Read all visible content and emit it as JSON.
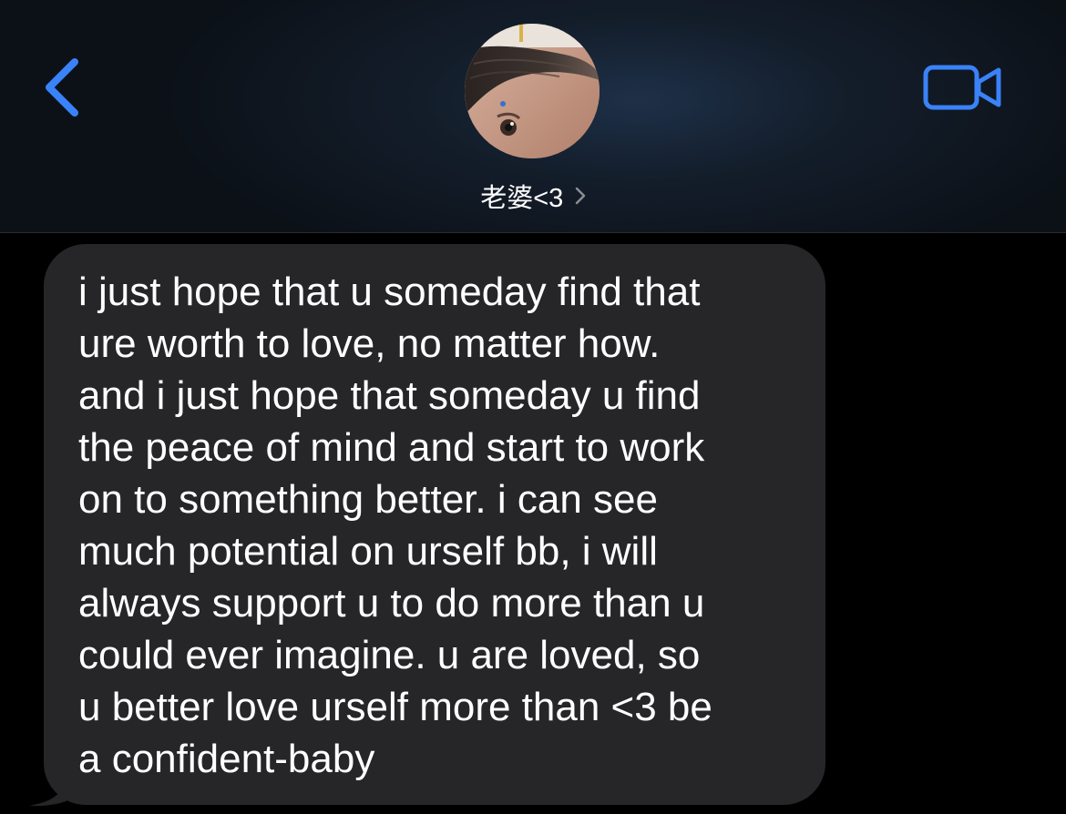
{
  "header": {
    "back_icon": "chevron-left-icon",
    "video_icon": "video-camera-icon",
    "accent_color": "#3a82f7",
    "contact": {
      "name": "老婆<3",
      "avatar": "contact-avatar-photo",
      "disclosure_icon": "chevron-right-icon"
    }
  },
  "messages": [
    {
      "direction": "received",
      "bubble_color": "#262629",
      "text": "i just hope that u someday find that\nure worth to love, no matter how.\nand i just hope that someday u find\nthe peace of mind and start to work\non to something better. i can see\nmuch potential on urself bb, i will\nalways support u to do more than u\ncould ever imagine. u are loved, so\nu better love urself more than <3 be\na confident-baby"
    }
  ]
}
